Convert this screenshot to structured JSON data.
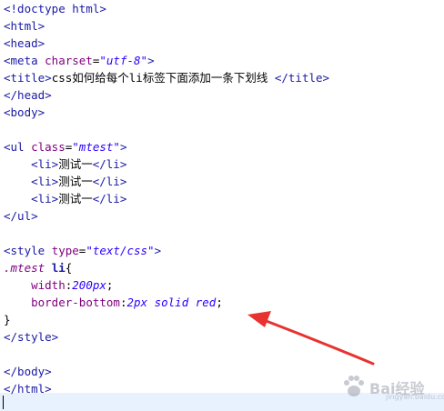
{
  "code": {
    "l1": "<!doctype html>",
    "l2": "<html>",
    "l3": "<head>",
    "l4_tag": "<meta ",
    "l4_attr": "charset",
    "l4_eq": "=",
    "l4_val": "\"utf-8\"",
    "l4_end": ">",
    "l5_open": "<title>",
    "l5_text": "css如何给每个li标签下面添加一条下划线 ",
    "l5_close": "</title>",
    "l6": "</head>",
    "l7": "<body>",
    "l9_tag": "<ul ",
    "l9_attr": "class",
    "l9_eq": "=",
    "l9_val": "\"mtest\"",
    "l9_end": ">",
    "li_indent": "    ",
    "li_open": "<li>",
    "li_text": "测试一",
    "li_close": "</li>",
    "l13": "</ul>",
    "l15_tag": "<style ",
    "l15_attr": "type",
    "l15_eq": "=",
    "l15_val": "\"text/css\"",
    "l15_end": ">",
    "l16_sel": ".mtest",
    "l16_sp": " ",
    "l16_tag": "li",
    "l16_brace": "{",
    "l17_indent": "    ",
    "l17_prop": "width",
    "l17_colon": ":",
    "l17_val": "200px",
    "l17_semi": ";",
    "l18_indent": "    ",
    "l18_prop": "border-bottom",
    "l18_colon": ":",
    "l18_val": "2px solid red",
    "l18_semi": ";",
    "l19": "}",
    "l20": "</style>",
    "l22": "</body>",
    "l23": "</html>"
  },
  "watermark": {
    "brand": "Bai经验",
    "sub": "jingyan.baidu.com"
  },
  "colors": {
    "arrow": "#e8322f",
    "tag": "#1a1aa6",
    "attribute": "#7f007f",
    "string": "#2a00ff"
  }
}
